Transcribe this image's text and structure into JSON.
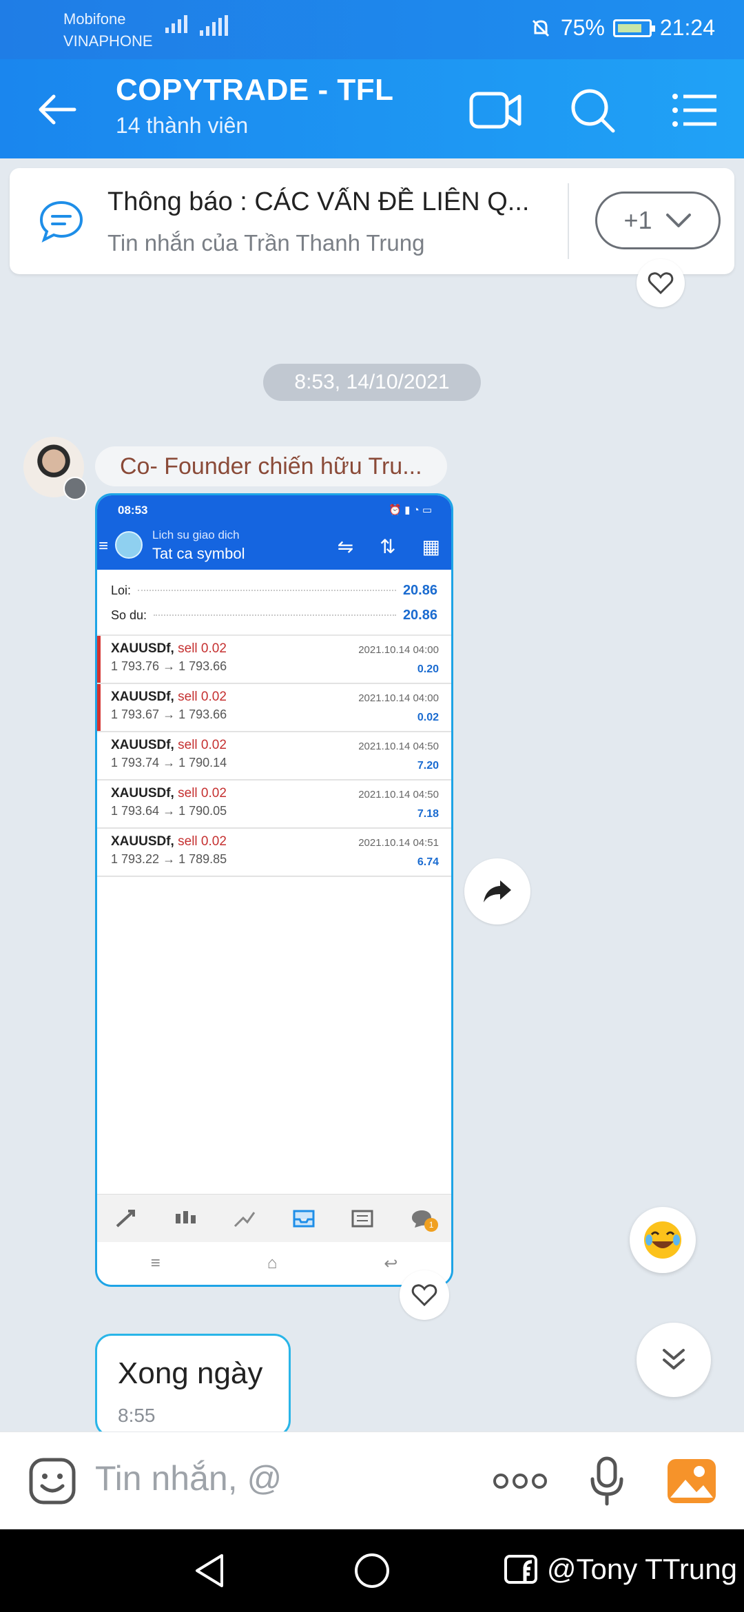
{
  "status": {
    "carrier1": "Mobifone",
    "carrier2": "VINAPHONE",
    "battery": "75%",
    "time": "21:24"
  },
  "header": {
    "title": "COPYTRADE - TFL",
    "members": "14 thành viên"
  },
  "pinned": {
    "title": "Thông báo : CÁC VẤN ĐỀ LIÊN Q...",
    "subtitle": "Tin nhắn của Trần Thanh Trung",
    "count": "+1"
  },
  "chat": {
    "timestamp": "8:53, 14/10/2021",
    "sender": "Co- Founder chiến hữu Tru...",
    "second_message": {
      "text": "Xong ngày",
      "time": "8:55"
    }
  },
  "screenshot": {
    "status_time": "08:53",
    "header_line1": "Lich su giao dich",
    "header_line2": "Tat ca symbol",
    "loi_label": "Loi:",
    "loi_value": "20.86",
    "sodu_label": "So du:",
    "sodu_value": "20.86",
    "trades": [
      {
        "symbol": "XAUUSDf,",
        "side": "sell 0.02",
        "price": "1 793.76 → 1 793.66",
        "time": "2021.10.14 04:00",
        "profit": "0.20",
        "marked": true
      },
      {
        "symbol": "XAUUSDf,",
        "side": "sell 0.02",
        "price": "1 793.67 → 1 793.66",
        "time": "2021.10.14 04:00",
        "profit": "0.02",
        "marked": true
      },
      {
        "symbol": "XAUUSDf,",
        "side": "sell 0.02",
        "price": "1 793.74 → 1 790.14",
        "time": "2021.10.14 04:50",
        "profit": "7.20",
        "marked": false
      },
      {
        "symbol": "XAUUSDf,",
        "side": "sell 0.02",
        "price": "1 793.64 → 1 790.05",
        "time": "2021.10.14 04:50",
        "profit": "7.18",
        "marked": false
      },
      {
        "symbol": "XAUUSDf,",
        "side": "sell 0.02",
        "price": "1 793.22 → 1 789.85",
        "time": "2021.10.14 04:51",
        "profit": "6.74",
        "marked": false
      }
    ],
    "chat_badge": "1"
  },
  "input": {
    "placeholder": "Tin nhắn, @"
  },
  "watermark": "@Tony TTrung",
  "colors": {
    "accent": "#1a86ee",
    "bubble_border": "#29b5e8",
    "profit": "#1a6bd0",
    "sell": "#c53030"
  }
}
